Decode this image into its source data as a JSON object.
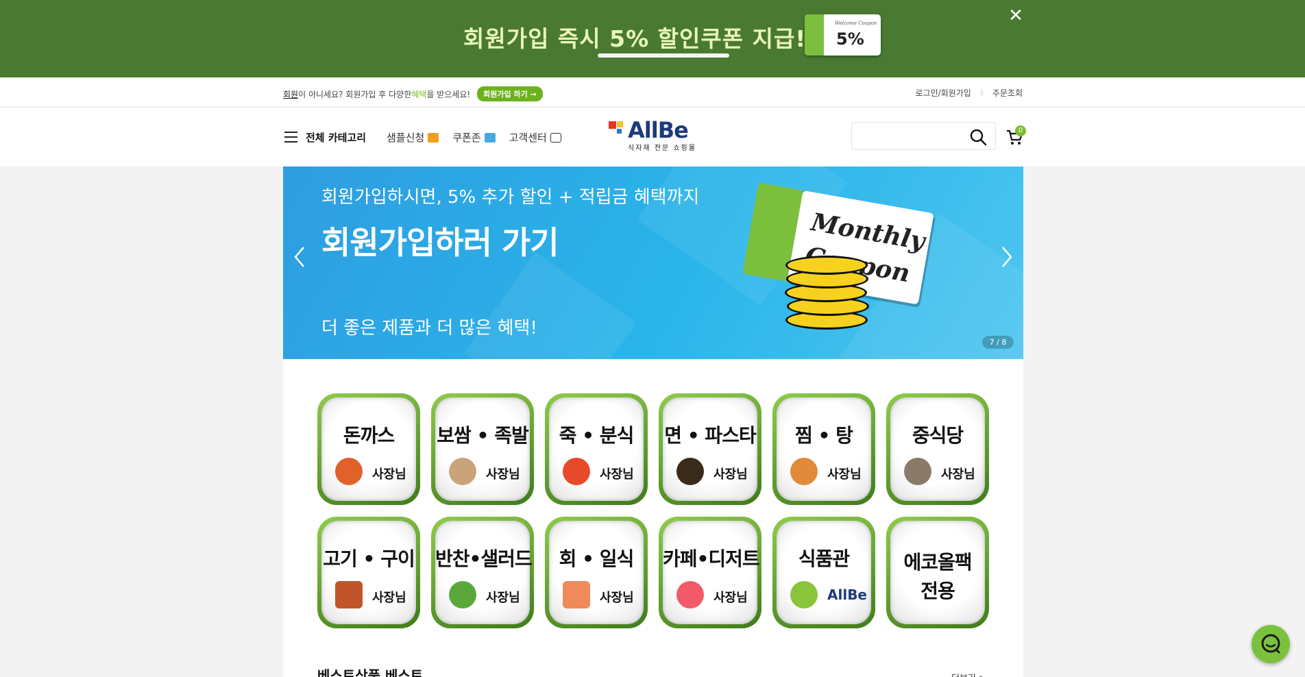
{
  "promo": {
    "text": "회원가입 즉시 5% 할인쿠폰 지급!!!",
    "coupon_small": "Welcome Coupon",
    "coupon_value": "5%",
    "close_icon": "close-icon"
  },
  "util_bar": {
    "member_word": "회원",
    "notice_mid": "이 아니세요? 회원가입 후 다양한 ",
    "benefit_word": "혜택",
    "notice_end": "을 받으세요!",
    "join_button": "회원가입 하기 →",
    "login_link": "로그인/회원가입",
    "order_link": "주문조회"
  },
  "header": {
    "all_categories": "전체 카테고리",
    "nav": [
      {
        "label": "샘플신청",
        "icon": "gift-icon"
      },
      {
        "label": "쿠폰존",
        "icon": "ticket-icon"
      },
      {
        "label": "고객센터",
        "icon": "chat-bubble-icon"
      }
    ],
    "logo_text": "AllBe",
    "logo_tagline": "식자재 전문 쇼핑몰",
    "search_placeholder": "",
    "cart_count": "0"
  },
  "hero": {
    "subtitle": "회원가입하시면, 5% 추가 할인 + 적립금 혜택까지",
    "title": "회원가입하러 가기",
    "bottom": "더 좋은 제품과 더 많은 혜택!",
    "coupon_line1": "Monthly",
    "coupon_line2": "Coupon",
    "counter": "7 / 8",
    "colors": {
      "bg": "#2ab5ea",
      "coupon_stub": "#7cbf3d",
      "coin": "#f6d21e"
    }
  },
  "categories": [
    {
      "title": "돈까스",
      "sub": "사장님",
      "food_color": "#e0622a"
    },
    {
      "title": "보쌈 • 족발",
      "sub": "사장님",
      "food_color": "#c9a47a"
    },
    {
      "title": "죽 • 분식",
      "sub": "사장님",
      "food_color": "#e64a2a"
    },
    {
      "title": "면 • 파스타",
      "sub": "사장님",
      "food_color": "#3a2a1a"
    },
    {
      "title": "찜 • 탕",
      "sub": "사장님",
      "food_color": "#e08a3a"
    },
    {
      "title": "중식당",
      "sub": "사장님",
      "food_color": "#8a7a6a"
    },
    {
      "title": "고기 • 구이",
      "sub": "사장님",
      "food_color": "#c0552a"
    },
    {
      "title": "반찬•샐러드",
      "sub": "사장님",
      "food_color": "#5aa83a"
    },
    {
      "title": "회 • 일식",
      "sub": "사장님",
      "food_color": "#f08a5a"
    },
    {
      "title": "카페•디저트",
      "sub": "사장님",
      "food_color": "#f25a6a"
    },
    {
      "title": "식품관",
      "sub": "AllBe",
      "food_color": "#8ac43a"
    },
    {
      "title_line1": "에코올팩",
      "title_line2": "전용"
    }
  ],
  "section": {
    "title": "베스트상품 베스트",
    "more": "더보기 >"
  },
  "colors": {
    "brand_green": "#4a7a32",
    "accent_green": "#6cb11f",
    "brand_blue": "#1c3b7a"
  }
}
